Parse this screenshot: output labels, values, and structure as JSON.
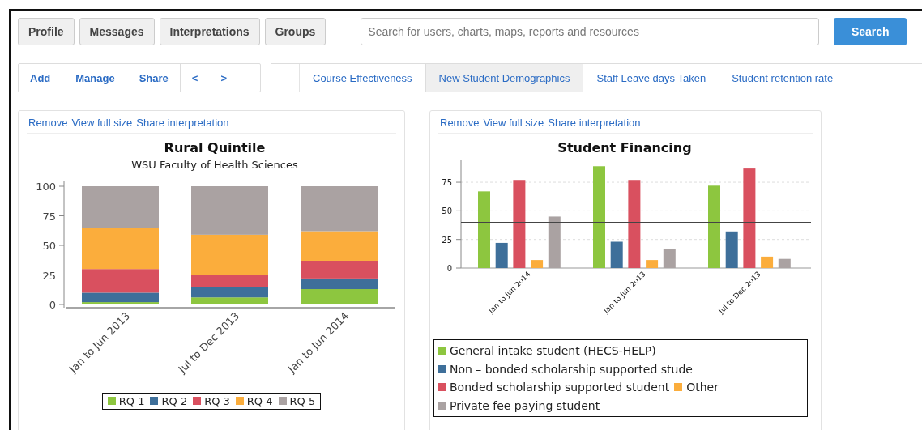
{
  "nav_buttons": [
    "Profile",
    "Messages",
    "Interpretations",
    "Groups"
  ],
  "search": {
    "placeholder": "Search for users, charts, maps, reports and resources",
    "button": "Search"
  },
  "toolbar": [
    "Add",
    "Manage",
    "Share",
    "<",
    ">"
  ],
  "tabs": [
    {
      "label": "Course Effectiveness",
      "selected": false
    },
    {
      "label": "New Student Demographics",
      "selected": true
    },
    {
      "label": "Staff Leave days Taken",
      "selected": false
    },
    {
      "label": "Student retention rate",
      "selected": false
    }
  ],
  "cards": [
    {
      "links": [
        "Remove",
        "View full size",
        "Share interpretation"
      ],
      "chart_data": {
        "type": "bar",
        "title": "Rural Quintile",
        "subtitle": "WSU  Faculty of Health Sciences",
        "stacked": true,
        "categories": [
          "Jan to Jun 2013",
          "Jul to Dec 2013",
          "Jan to Jun 2014"
        ],
        "ylim": [
          0,
          100
        ],
        "yticks": [
          0,
          25,
          50,
          75,
          100
        ],
        "series": [
          {
            "name": "RQ 1",
            "color": "#8dc63f",
            "values": [
              2,
              6,
              13
            ]
          },
          {
            "name": "RQ 2",
            "color": "#3e6f9a",
            "values": [
              8,
              9,
              9
            ]
          },
          {
            "name": "RQ 3",
            "color": "#d9505f",
            "values": [
              20,
              10,
              15
            ]
          },
          {
            "name": "RQ 4",
            "color": "#fbad3c",
            "values": [
              35,
              34,
              25
            ]
          },
          {
            "name": "RQ 5",
            "color": "#aaa2a2",
            "values": [
              35,
              41,
              38
            ]
          }
        ],
        "legend": true
      }
    },
    {
      "links": [
        "Remove",
        "View full size",
        "Share interpretation"
      ],
      "chart_data": {
        "type": "bar",
        "title": "Student Financing",
        "stacked": false,
        "categories": [
          "Jan to Jun 2014",
          "Jan to Jun 2013",
          "Jul to Dec 2013"
        ],
        "ylim": [
          0,
          95
        ],
        "yticks": [
          0,
          25,
          50,
          75
        ],
        "grid": true,
        "ref_lines": [
          {
            "axis": "y",
            "value": 40
          }
        ],
        "legend": true,
        "series": [
          {
            "name": "General intake student (HECS-HELP)",
            "color": "#8dc63f",
            "values": [
              67,
              89,
              72
            ]
          },
          {
            "name": "Non – bonded scholarship supported stude",
            "color": "#3e6f9a",
            "values": [
              22,
              23,
              32
            ]
          },
          {
            "name": "Bonded scholarship supported student",
            "color": "#d9505f",
            "values": [
              77,
              77,
              87
            ]
          },
          {
            "name": "Other",
            "color": "#fbad3c",
            "values": [
              7,
              7,
              10
            ]
          },
          {
            "name": "Private fee paying student",
            "color": "#aaa2a2",
            "values": [
              45,
              17,
              8
            ]
          }
        ]
      }
    }
  ]
}
